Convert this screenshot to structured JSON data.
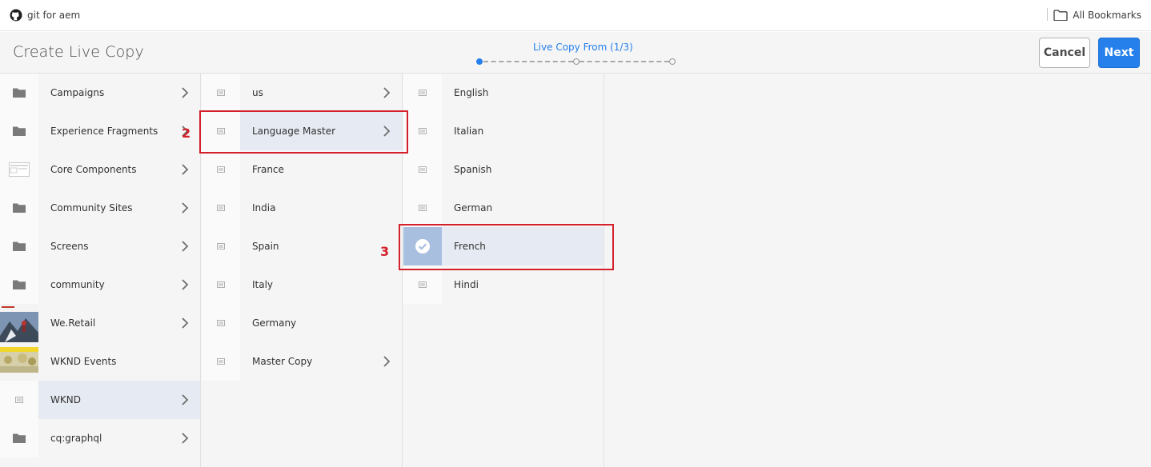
{
  "bookmarks_bar": {
    "left_label": "git for aem",
    "right_label": "All Bookmarks"
  },
  "header": {
    "title": "Create Live Copy",
    "wizard_step_label": "Live Copy From (1/3)",
    "wizard_steps_total": 3,
    "wizard_current_step": 1,
    "cancel_label": "Cancel",
    "next_label": "Next"
  },
  "columns": [
    {
      "items": [
        {
          "label": "Campaigns",
          "icon": "folder-icon",
          "has_children": true
        },
        {
          "label": "Experience Fragments",
          "icon": "folder-icon",
          "has_children": true
        },
        {
          "label": "Core Components",
          "icon": "template-thumbnail",
          "has_children": true
        },
        {
          "label": "Community Sites",
          "icon": "folder-icon",
          "has_children": true
        },
        {
          "label": "Screens",
          "icon": "folder-icon",
          "has_children": true
        },
        {
          "label": "community",
          "icon": "folder-icon",
          "has_children": true
        },
        {
          "label": "We.Retail",
          "icon": "image-thumbnail",
          "has_children": true
        },
        {
          "label": "WKND Events",
          "icon": "image-thumbnail",
          "has_children": false
        },
        {
          "label": "WKND",
          "icon": "page-icon",
          "has_children": true,
          "selected": true
        },
        {
          "label": "cq:graphql",
          "icon": "folder-icon",
          "has_children": true
        }
      ]
    },
    {
      "items": [
        {
          "label": "us",
          "icon": "page-icon",
          "has_children": true
        },
        {
          "label": "Language Master",
          "icon": "page-icon",
          "has_children": true,
          "selected": true
        },
        {
          "label": "France",
          "icon": "page-icon",
          "has_children": false
        },
        {
          "label": "India",
          "icon": "page-icon",
          "has_children": false
        },
        {
          "label": "Spain",
          "icon": "page-icon",
          "has_children": false
        },
        {
          "label": "Italy",
          "icon": "page-icon",
          "has_children": false
        },
        {
          "label": "Germany",
          "icon": "page-icon",
          "has_children": false
        },
        {
          "label": "Master Copy",
          "icon": "page-icon",
          "has_children": true
        }
      ]
    },
    {
      "items": [
        {
          "label": "English",
          "icon": "page-icon",
          "has_children": false
        },
        {
          "label": "Italian",
          "icon": "page-icon",
          "has_children": false
        },
        {
          "label": "Spanish",
          "icon": "page-icon",
          "has_children": false
        },
        {
          "label": "German",
          "icon": "page-icon",
          "has_children": false
        },
        {
          "label": "French",
          "icon": "checkmark-icon",
          "has_children": false,
          "checked": true
        },
        {
          "label": "Hindi",
          "icon": "page-icon",
          "has_children": false
        }
      ]
    }
  ],
  "annotations": [
    {
      "number": "2",
      "target": "Language Master"
    },
    {
      "number": "3",
      "target": "French"
    }
  ],
  "colors": {
    "accent": "#2680eb",
    "annotation": "#d3202b",
    "selected_row": "#e6eaf2",
    "checked_thumb": "#a9bfe0"
  }
}
